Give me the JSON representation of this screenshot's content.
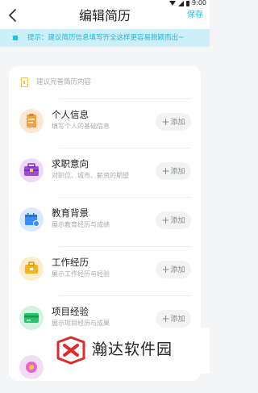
{
  "status_bar": {
    "time": "9:00"
  },
  "header": {
    "title": "编辑简历",
    "save_label": "保存"
  },
  "tip": {
    "text": "提示：建议简历信息填写齐全这样更容易脱颖而出~"
  },
  "card": {
    "header_text": "建议完善简历内容",
    "sections": [
      {
        "title": "个人信息",
        "subtitle": "填写个人的基础信息",
        "add_label": "添加",
        "icon": "personal-info-icon"
      },
      {
        "title": "求职意向",
        "subtitle": "对职位、城市、薪资的期望",
        "add_label": "添加",
        "icon": "job-intention-icon"
      },
      {
        "title": "教育背景",
        "subtitle": "展示教育经历与成绩",
        "add_label": "添加",
        "icon": "education-icon"
      },
      {
        "title": "工作经历",
        "subtitle": "展示工作经历与经验",
        "add_label": "添加",
        "icon": "work-experience-icon"
      },
      {
        "title": "项目经验",
        "subtitle": "展示项目经历与成果",
        "add_label": "添加",
        "icon": "project-icon"
      }
    ]
  },
  "watermark": {
    "text": "瀚达软件园"
  },
  "colors": {
    "accent": "#19c1e6",
    "tip_background": "#cdeff8",
    "personal_info": "#f5a14a",
    "job_intention": "#9b4cd8",
    "education": "#3a8df5",
    "work_experience": "#f5b324",
    "project": "#27c46b"
  }
}
